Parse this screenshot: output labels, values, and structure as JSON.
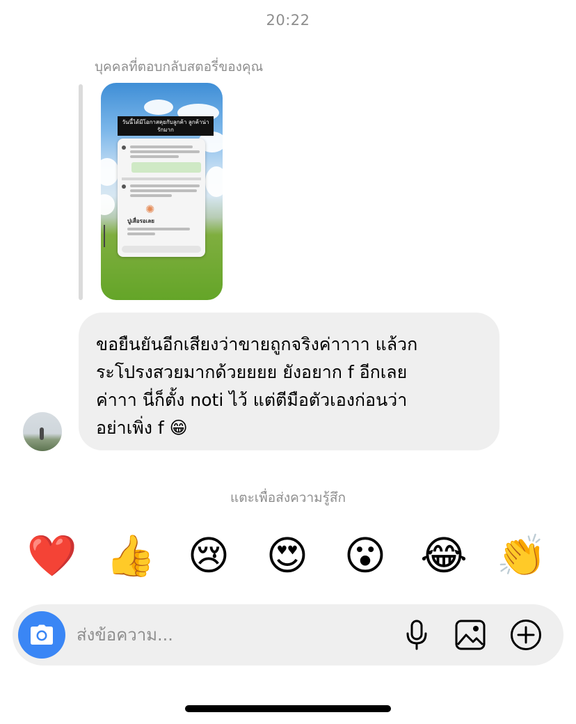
{
  "header": {
    "time": "20:22"
  },
  "story_reply": {
    "label": "บุคคลที่ตอบกลับสตอรี่ของคุณ",
    "thumbnail": {
      "caption": "วันนี้ได้มีโอกาสคุยกับลูกค้า ลูกค้าน่ารักมาก",
      "chat_title": "ปูเสื่อรอเลย"
    }
  },
  "message": {
    "lines": [
      "ขอยืนยันอีกเสียงว่าขายถูกจริงค่าาาา แล้วก",
      "ระโปรงสวยมากด้วยยยย ยังอยาก f อีกเลย",
      "ค่าาา นี่ก็ตั้ง noti ไว้ แต่ตีมือตัวเองก่อนว่า",
      "อย่าเพิ่ง f 😁"
    ]
  },
  "reactions": {
    "hint": "แตะเพื่อส่งความรู้สึก",
    "items": [
      "❤️",
      "👍",
      "😢",
      "😍",
      "😮",
      "😂",
      "👏"
    ]
  },
  "composer": {
    "placeholder": "ส่งข้อความ..."
  },
  "colors": {
    "bubble": "#efefef",
    "camera_button": "#3a86f5",
    "secondary_text": "#8e8e8e"
  },
  "icons": [
    "camera-icon",
    "microphone-icon",
    "image-icon",
    "plus-circle-icon"
  ]
}
